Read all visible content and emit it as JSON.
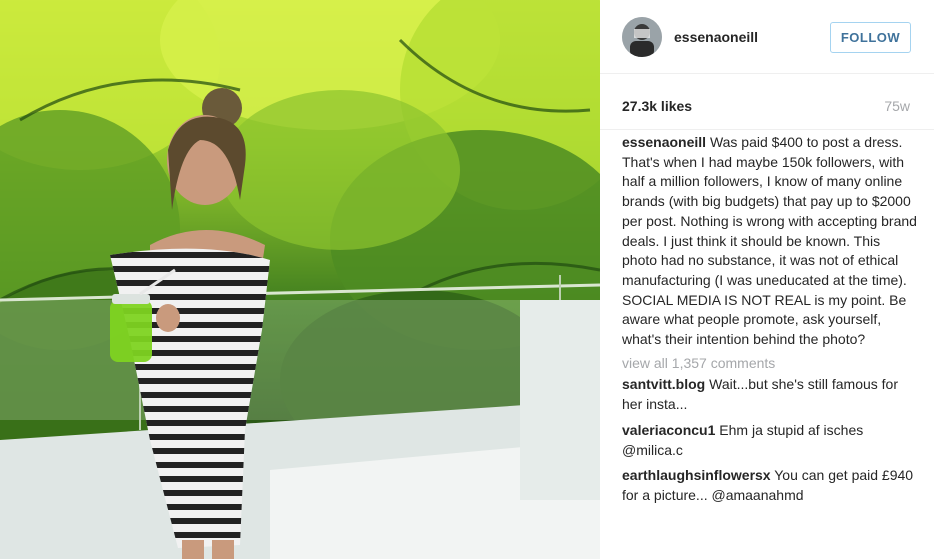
{
  "post": {
    "image_alt": "Woman in striped off-shoulder dress holding a green drink in a garden",
    "username": "essenaoneill",
    "follow_label": "FOLLOW",
    "likes": "27.3k likes",
    "age": "75w",
    "caption": {
      "user": "essenaoneill",
      "text": "Was paid $400 to post a dress. That's when I had maybe 150k followers, with half a million followers, I know of many online brands (with big budgets) that pay up to $2000 per post. Nothing is wrong with accepting brand deals. I just think it should be known. This photo had no substance, it was not of ethical manufacturing (I was uneducated at the time). SOCIAL MEDIA IS NOT REAL is my point. Be aware what people promote, ask yourself, what's their intention behind the photo?"
    },
    "view_all": "view all 1,357 comments",
    "comments": [
      {
        "user": "santvitt.blog",
        "text": "Wait...but she's still famous for her insta..."
      },
      {
        "user": "valeriaconcu1",
        "text": "Ehm ja stupid af isches @milica.c"
      },
      {
        "user": "earthlaughsinflowersx",
        "text": "You can get paid £940 for a picture... @amaanahmd"
      }
    ]
  },
  "colors": {
    "follow_text": "#3f729b",
    "follow_border": "#a5d3f0",
    "muted": "#a5a7aa",
    "text": "#262626"
  }
}
